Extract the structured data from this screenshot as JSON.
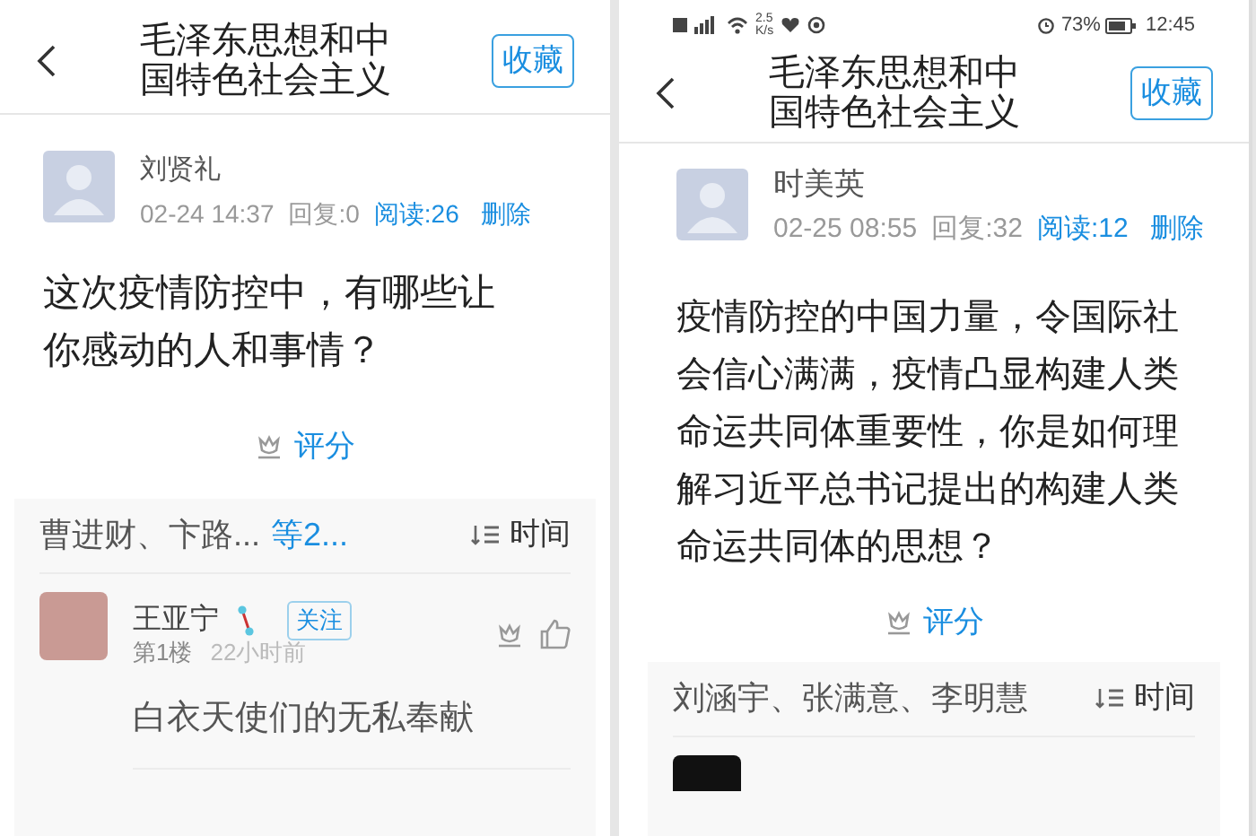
{
  "panels": [
    {
      "header": {
        "title": "毛泽东思想和中国特色社会主义",
        "collect_button": "收藏"
      },
      "post": {
        "author": "刘贤礼",
        "date": "02-24 14:37",
        "replies": "回复:0",
        "reads": "阅读:26",
        "delete": "删除",
        "question": "这次疫情防控中，有哪些让你感动的人和事情？"
      },
      "rate_label": "评分",
      "comments": {
        "participants": "曹进财、卞路...",
        "more_link": "等2...",
        "sort_label": "时间",
        "items": [
          {
            "kind": "photo",
            "author": "王亚宁",
            "follow": "关注",
            "floor": "第1楼",
            "time": "22小时前",
            "text": "白衣天使们的无私奉献"
          }
        ]
      }
    },
    {
      "status_bar": {
        "speed": "2.5",
        "speed_unit": "K/s",
        "battery": "73%",
        "time": "12:45"
      },
      "header": {
        "title": "毛泽东思想和中国特色社会主义",
        "collect_button": "收藏"
      },
      "post": {
        "author": "时美英",
        "date": "02-25 08:55",
        "replies": "回复:32",
        "reads": "阅读:12",
        "delete": "删除",
        "question": "疫情防控的中国力量，令国际社会信心满满，疫情凸显构建人类命运共同体重要性，你是如何理解习近平总书记提出的构建人类命运共同体的思想？"
      },
      "rate_label": "评分",
      "comments": {
        "participants": "刘涵宇、张满意、李明慧",
        "sort_label": "时间",
        "items": [
          {
            "kind": "cut"
          }
        ]
      }
    }
  ]
}
